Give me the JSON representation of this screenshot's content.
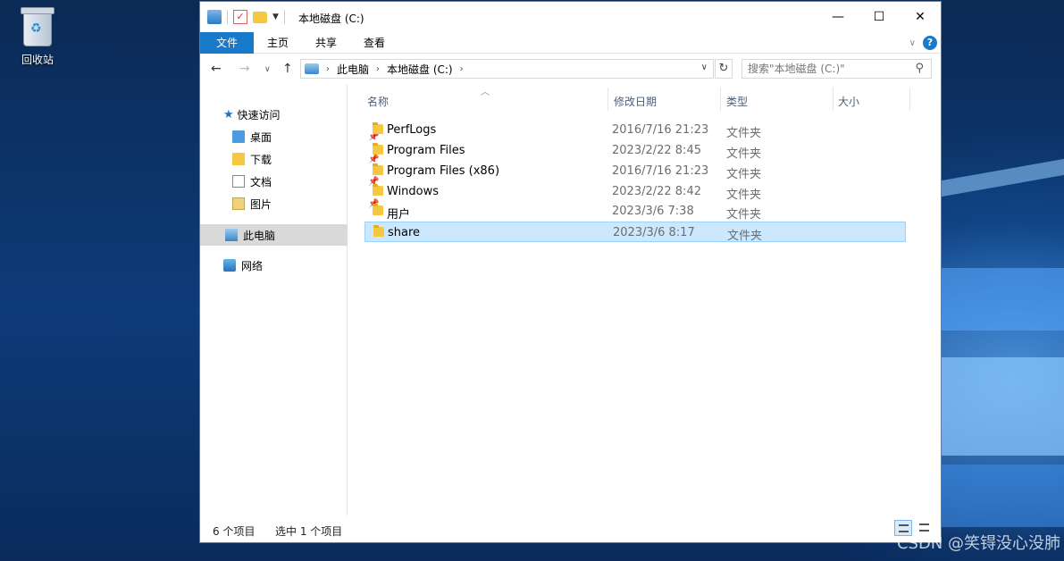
{
  "desktop": {
    "recycle_bin_label": "回收站",
    "watermark": "CSDN @笑锝没心没肺"
  },
  "window": {
    "title": "本地磁盘 (C:)",
    "caption": {
      "minimize": "—",
      "maximize": "☐",
      "close": "✕"
    }
  },
  "ribbon": {
    "tabs": [
      "文件",
      "主页",
      "共享",
      "查看"
    ],
    "help": "?"
  },
  "address": {
    "crumbs": [
      "此电脑",
      "本地磁盘 (C:)"
    ],
    "search_placeholder": "搜索\"本地磁盘 (C:)\""
  },
  "nav": {
    "quick_access": "快速访问",
    "items": [
      {
        "label": "桌面",
        "pinned": true
      },
      {
        "label": "下载",
        "pinned": true
      },
      {
        "label": "文档",
        "pinned": true
      },
      {
        "label": "图片",
        "pinned": true
      }
    ],
    "this_pc": "此电脑",
    "network": "网络"
  },
  "columns": [
    "名称",
    "修改日期",
    "类型",
    "大小"
  ],
  "files": [
    {
      "name": "PerfLogs",
      "date": "2016/7/16 21:23",
      "type": "文件夹",
      "selected": false
    },
    {
      "name": "Program Files",
      "date": "2023/2/22 8:45",
      "type": "文件夹",
      "selected": false
    },
    {
      "name": "Program Files (x86)",
      "date": "2016/7/16 21:23",
      "type": "文件夹",
      "selected": false
    },
    {
      "name": "Windows",
      "date": "2023/2/22 8:42",
      "type": "文件夹",
      "selected": false
    },
    {
      "name": "用户",
      "date": "2023/3/6 7:38",
      "type": "文件夹",
      "selected": false
    },
    {
      "name": "share",
      "date": "2023/3/6 8:17",
      "type": "文件夹",
      "selected": true
    }
  ],
  "status": {
    "item_count": "6 个项目",
    "selected_count": "选中 1 个项目"
  }
}
